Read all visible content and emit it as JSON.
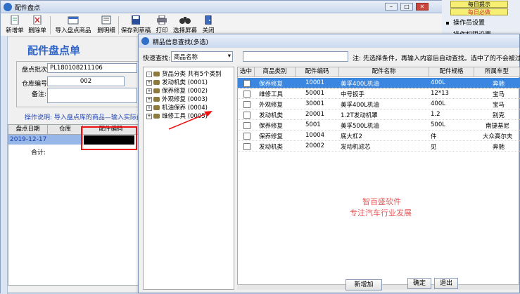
{
  "main_window": {
    "title": "配件盘点"
  },
  "toolbar": [
    {
      "label": "新增单",
      "icon": "new-doc-icon"
    },
    {
      "label": "删除单",
      "icon": "delete-doc-icon"
    },
    {
      "label": "导入盘点商品",
      "icon": "import-icon"
    },
    {
      "label": "删明细",
      "icon": "delete-detail-icon"
    },
    {
      "label": "保存到草稿",
      "icon": "save-icon"
    },
    {
      "label": "打印",
      "icon": "print-icon"
    },
    {
      "label": "选择屏幕",
      "icon": "binoculars-icon"
    },
    {
      "label": "关闭",
      "icon": "close-door-icon"
    }
  ],
  "form": {
    "title": "配件盘点单",
    "batch_label": "盘点批次:",
    "batch_value": "PL180108211106",
    "warehouse_label": "仓库编号:",
    "warehouse_value": "002",
    "note_label": "备注:"
  },
  "howto": "操作说明: 导入盘点库的商品—输入实际盘",
  "left_grid": {
    "headers": [
      "盘点日期",
      "仓库",
      "配件编码"
    ],
    "date": "2019-12-17",
    "total_label": "合计:"
  },
  "right_panel": {
    "tips": [
      "每日提示",
      "每日必做"
    ],
    "items": [
      "操作员设置",
      "操作权限设置"
    ]
  },
  "dialog": {
    "title": "精品信息查找(多选)",
    "quick_search_label": "快速查找:",
    "quick_search_value": "商品名称",
    "note": "注: 先选择条件，再输入内容后自动查找。选中了的不会被过滤掉。",
    "tree": [
      "货品分类  共有5个类别",
      "发动机类 (0001)",
      "保养修复 (0002)",
      "外观修复 (0003)",
      "机油保养 (0004)",
      "维修工具 (0005)"
    ],
    "columns": [
      "选中",
      "商品类别",
      "配件编码",
      "配件名称",
      "配件规格",
      "所属车型"
    ],
    "rows": [
      {
        "cat": "保养修复",
        "code": "10001",
        "name": "美孚400L机油",
        "spec": "400L",
        "car": "奔驰"
      },
      {
        "cat": "维修工具",
        "code": "50001",
        "name": "中号扳手",
        "spec": "12*13",
        "car": "宝马"
      },
      {
        "cat": "外观修复",
        "code": "30001",
        "name": "美孚400L机油",
        "spec": "400L",
        "car": "宝马"
      },
      {
        "cat": "发动机类",
        "code": "20001",
        "name": "1.2T发动机罩",
        "spec": "1.2",
        "car": "别克"
      },
      {
        "cat": "保养修复",
        "code": "5001",
        "name": "美孚500L机油",
        "spec": "500L",
        "car": "南捷基尼"
      },
      {
        "cat": "保养修复",
        "code": "10004",
        "name": "底大杠2",
        "spec": "件",
        "car": "大众高尔夫"
      },
      {
        "cat": "发动机类",
        "code": "20002",
        "name": "发动机滤芯",
        "spec": "见",
        "car": "奔驰"
      }
    ],
    "watermark": [
      "智百盛软件",
      "专注汽车行业发展"
    ],
    "buttons": {
      "add": "新增加",
      "ok": "确定",
      "exit": "退出"
    }
  },
  "accent_colors": {
    "title_blue": "#2f64c8",
    "selection": "#3a86e0",
    "highlight_red": "#e11111",
    "tip_yellow": "#f6ef74"
  }
}
